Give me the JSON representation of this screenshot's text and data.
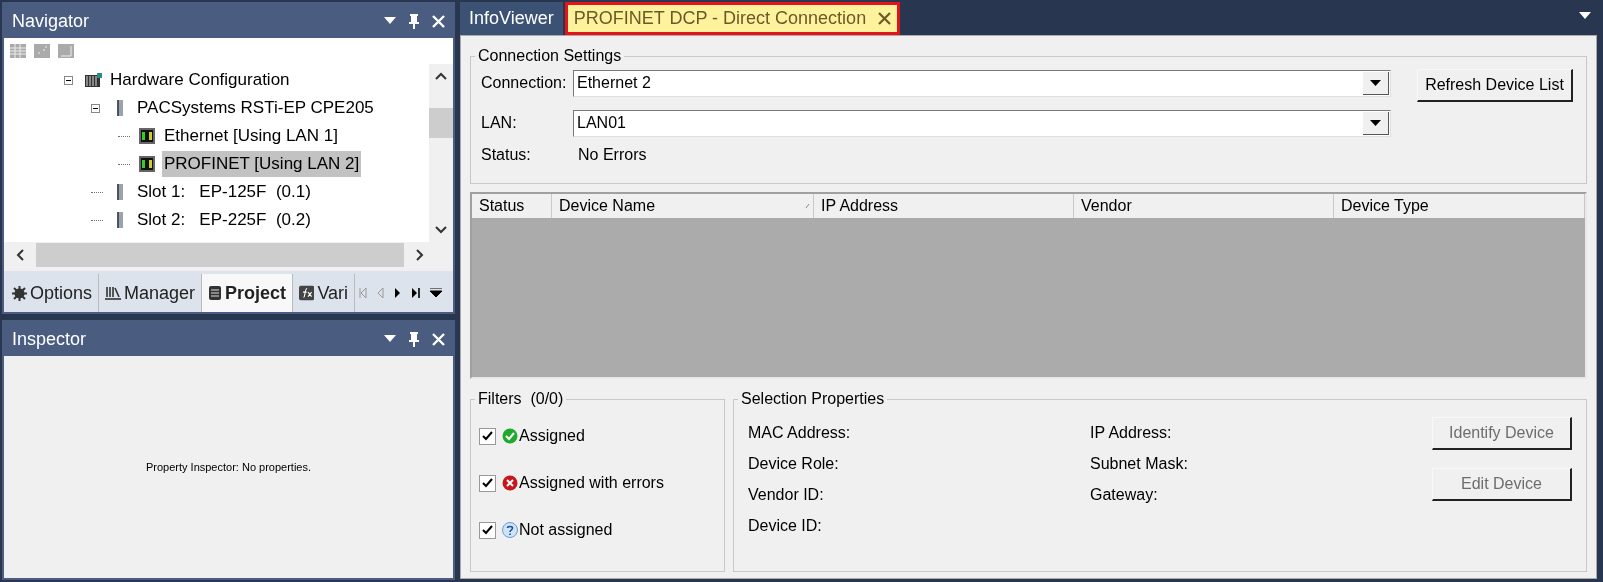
{
  "navigator": {
    "title": "Navigator",
    "tree": [
      {
        "label": "Hardware Configuration",
        "kind": "rack",
        "expanded": true,
        "selected": false,
        "children": [
          {
            "label": "PACSystems RSTi-EP CPE205",
            "kind": "module",
            "expanded": true,
            "selected": false,
            "children": [
              {
                "label": "Ethernet [Using LAN 1]",
                "kind": "port",
                "selected": false
              },
              {
                "label": "PROFINET [Using LAN 2]",
                "kind": "port",
                "selected": true
              }
            ]
          },
          {
            "label": "Slot 1:   EP-125F  (0.1)",
            "kind": "module",
            "selected": false
          },
          {
            "label": "Slot 2:   EP-225F  (0.2)",
            "kind": "module",
            "selected": false
          }
        ]
      }
    ],
    "tabs": [
      {
        "label": "Options",
        "kind": "gear",
        "selected": false
      },
      {
        "label": "Manager",
        "kind": "books",
        "selected": false
      },
      {
        "label": "Project",
        "kind": "list",
        "selected": true
      },
      {
        "label": "Vari",
        "kind": "fx",
        "selected": false
      }
    ]
  },
  "inspector": {
    "title": "Inspector",
    "message": "Property Inspector: No properties."
  },
  "document_tabs": [
    {
      "label": "InfoViewer",
      "selected": false,
      "closable": false
    },
    {
      "label": "PROFINET DCP - Direct Connection",
      "selected": true,
      "closable": true
    }
  ],
  "connection_settings": {
    "title": "Connection Settings",
    "connection": {
      "label": "Connection:",
      "value": "Ethernet 2"
    },
    "lan": {
      "label": "LAN:",
      "value": "LAN01"
    },
    "status": {
      "label": "Status:",
      "value": "No Errors"
    },
    "refresh_button": {
      "label": "Refresh Device List",
      "disabled": false
    }
  },
  "device_table": {
    "columns": [
      "Status",
      "Device Name",
      "IP Address",
      "Vendor",
      "Device Type"
    ]
  },
  "filters": {
    "title": "Filters  (0/0)",
    "items": [
      {
        "label": "Assigned",
        "kind": "ok",
        "checked": true
      },
      {
        "label": "Assigned with errors",
        "kind": "error",
        "checked": true
      },
      {
        "label": "Not assigned",
        "kind": "unknown",
        "checked": true
      }
    ]
  },
  "selection_properties": {
    "title": "Selection Properties",
    "left_fields": [
      "MAC Address:",
      "Device Role:",
      "Vendor ID:",
      "Device ID:"
    ],
    "right_fields": [
      "IP Address:",
      "Subnet Mask:",
      "Gateway:"
    ],
    "buttons": [
      {
        "label": "Identify Device",
        "disabled": true
      },
      {
        "label": "Edit Device",
        "disabled": true
      }
    ]
  }
}
